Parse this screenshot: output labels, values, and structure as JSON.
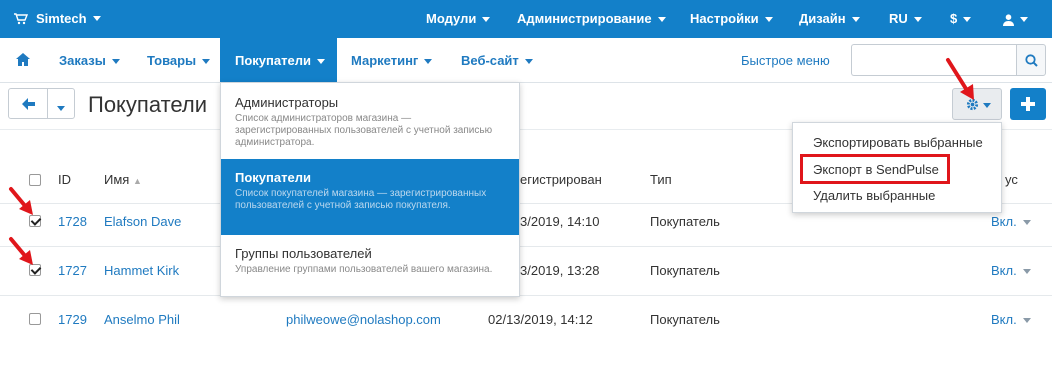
{
  "topbar": {
    "brand": "Simtech",
    "items": [
      "Модули",
      "Администрирование",
      "Настройки",
      "Дизайн",
      "RU",
      "$"
    ]
  },
  "subnav": {
    "items": [
      "Заказы",
      "Товары",
      "Покупатели",
      "Маркетинг",
      "Веб-сайт"
    ],
    "active": "Покупатели",
    "quick_menu": "Быстрое меню",
    "search_placeholder": ""
  },
  "toolbar": {
    "title": "Покупатели"
  },
  "table": {
    "headers": {
      "id": "ID",
      "name": "Имя",
      "registered": "егистрирован",
      "type": "Тип",
      "status": "ус"
    },
    "rows": [
      {
        "checked": true,
        "id": "1728",
        "name": "Elafson Dave",
        "email": "",
        "date": "3/2019, 14:10",
        "type": "Покупатель",
        "status": "Вкл."
      },
      {
        "checked": true,
        "id": "1727",
        "name": "Hammet Kirk",
        "email": "",
        "date": "3/2019, 13:28",
        "type": "Покупатель",
        "status": "Вкл."
      },
      {
        "checked": false,
        "id": "1729",
        "name": "Anselmo Phil",
        "email": "philweowe@nolashop.com",
        "date": "02/13/2019, 14:12",
        "type": "Покупатель",
        "status": "Вкл."
      }
    ]
  },
  "customers_menu": [
    {
      "title": "Администраторы",
      "desc": "Список администраторов магазина — зарегистрированных пользователей с учетной записью администратора."
    },
    {
      "title": "Покупатели",
      "desc": "Список покупателей магазина — зарегистрированных пользователей с учетной записью покупателя."
    },
    {
      "title": "Группы пользователей",
      "desc": "Управление группами пользователей вашего магазина."
    }
  ],
  "gear_menu": [
    "Экспортировать выбранные",
    "Экспорт в SendPulse",
    "Удалить выбранные"
  ],
  "colors": {
    "primary": "#1380c9",
    "link": "#1f7ac0",
    "annotation": "#e0161b"
  }
}
